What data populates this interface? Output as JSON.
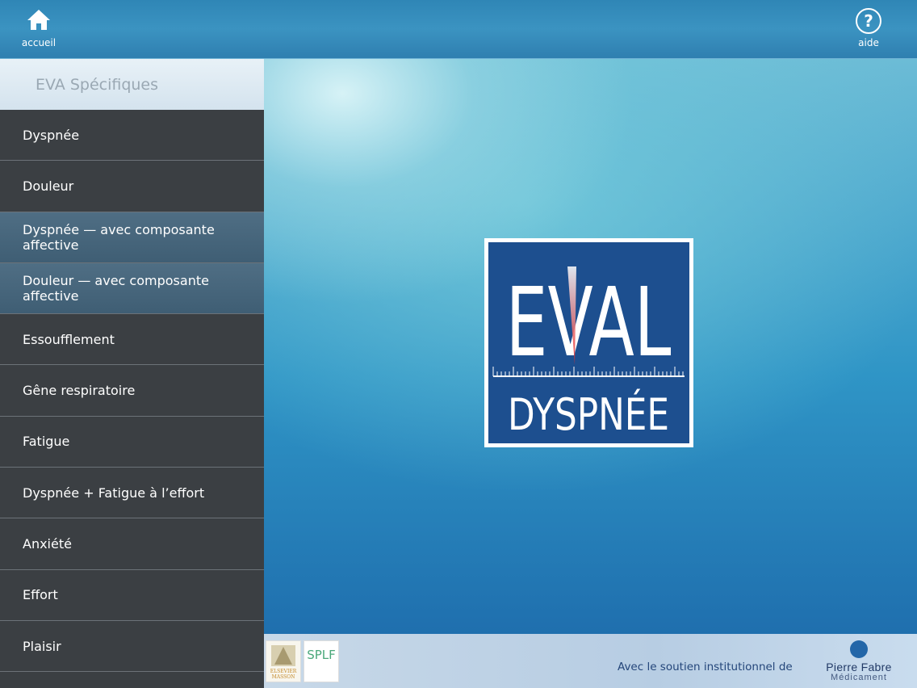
{
  "header": {
    "home_label": "accueil",
    "help_label": "aide"
  },
  "sidebar": {
    "title": "EVA Spécifiques",
    "items": [
      {
        "label": "Dyspnée"
      },
      {
        "label": "Douleur"
      },
      {
        "label": "Dyspnée — avec composante affective"
      },
      {
        "label": "Douleur — avec composante affective"
      },
      {
        "label": "Essoufflement"
      },
      {
        "label": "Gêne respiratoire"
      },
      {
        "label": "Fatigue"
      },
      {
        "label": "Dyspnée + Fatigue à l’effort"
      },
      {
        "label": "Anxiété"
      },
      {
        "label": "Effort"
      },
      {
        "label": "Plaisir"
      }
    ]
  },
  "main": {
    "logo_top": "EVAL",
    "logo_bottom": "DYSPNÉE"
  },
  "footer": {
    "publisher1": "ELSEVIER MASSON",
    "publisher2": "SPLF",
    "support_text": "Avec le soutien institutionnel de",
    "sponsor_name": "Pierre Fabre",
    "sponsor_sub": "Médicament"
  },
  "colors": {
    "sidebar_bg": "#3b3f43",
    "highlight_item": "#4f6e84",
    "logo_blue": "#1d4f8f",
    "accent_red": "#e02020"
  }
}
